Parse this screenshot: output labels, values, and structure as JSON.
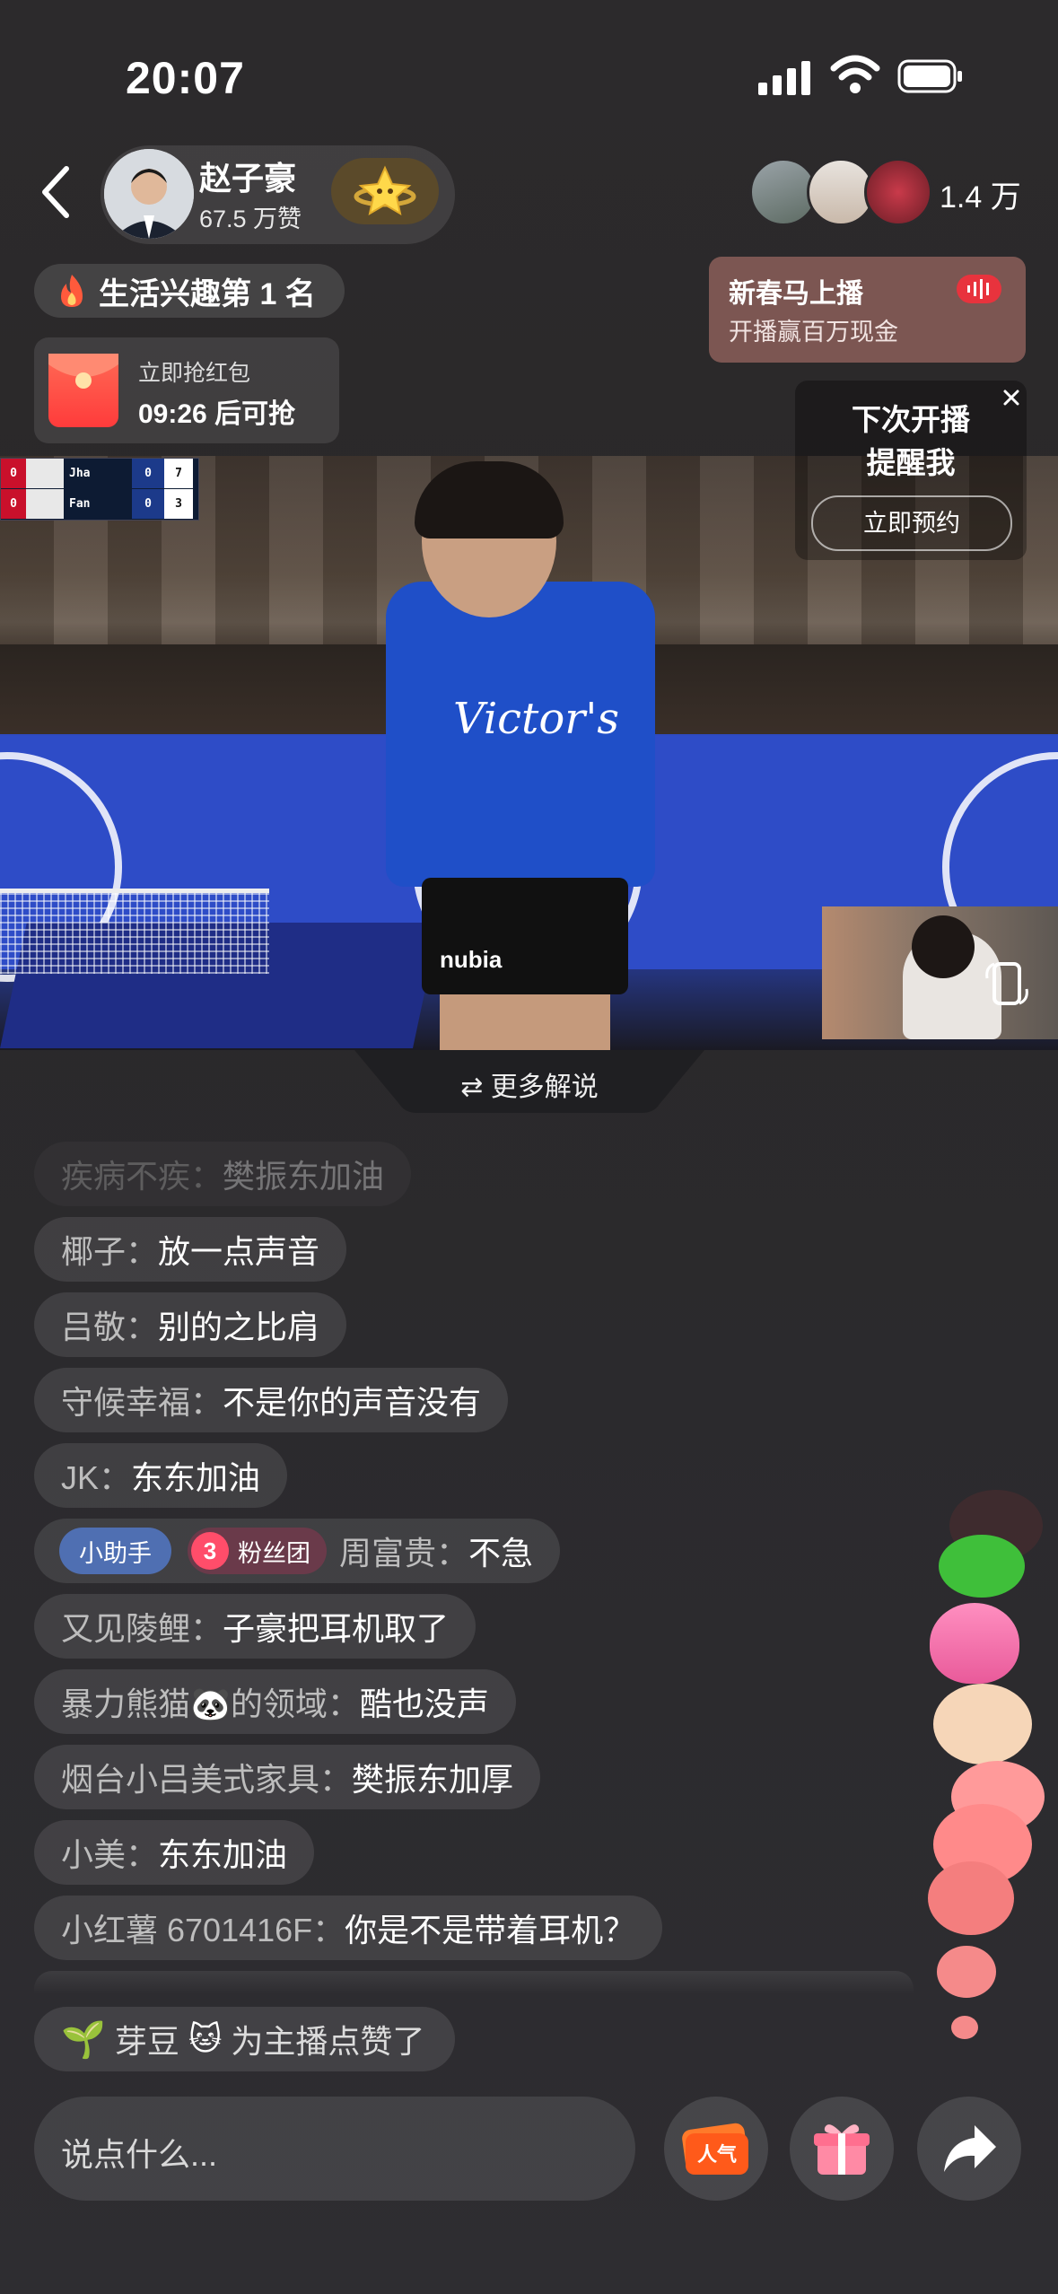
{
  "status_bar": {
    "time": "20:07"
  },
  "host": {
    "name": "赵子豪",
    "likes": "67.5 万赞"
  },
  "viewers": {
    "count": "1.4 万"
  },
  "rank": {
    "label": "生活兴趣第 1 名"
  },
  "promo": {
    "title": "新春马上播",
    "subtitle": "开播赢百万现金"
  },
  "red_packet": {
    "title": "立即抢红包",
    "countdown": "09:26 后可抢"
  },
  "remind": {
    "line1": "下次开播",
    "line2": "提醒我",
    "button": "立即预约"
  },
  "scoreboard": {
    "rows": [
      {
        "sets": "0",
        "name": "Jha",
        "games": "0",
        "points": "7"
      },
      {
        "sets": "0",
        "name": "Fan",
        "games": "0",
        "points": "3"
      }
    ]
  },
  "video_overlay": {
    "jersey_text": "Victor's",
    "sponsor": "nubia"
  },
  "more_commentary": {
    "label": "更多解说"
  },
  "comments": [
    {
      "user": "疾病不疾：",
      "text": "樊振东加油"
    },
    {
      "user": "椰子：",
      "text": "放一点声音"
    },
    {
      "user": "吕敬：",
      "text": "别的之比肩"
    },
    {
      "user": "守候幸福：",
      "text": "不是你的声音没有"
    },
    {
      "user": "JK：",
      "text": "东东加油"
    },
    {
      "helper_badge": "小助手",
      "fan_level": "3",
      "fan_badge": "粉丝团",
      "user": "周富贵：",
      "text": "不急"
    },
    {
      "user": "又见陵鲤：",
      "text": "子豪把耳机取了"
    },
    {
      "user": "暴力熊猫🐼的领域：",
      "text": "酷也没声"
    },
    {
      "user": "烟台小吕美式家具：",
      "text": "樊振东加厚"
    },
    {
      "user": "小美：",
      "text": "东东加油"
    },
    {
      "user": "小红薯 6701416F：",
      "text": "你是不是带着耳机？"
    }
  ],
  "like_notice": {
    "user": "芽豆",
    "text": "为主播点赞了"
  },
  "input": {
    "placeholder": "说点什么..."
  },
  "buttons": {
    "popularity_label": "人气"
  }
}
